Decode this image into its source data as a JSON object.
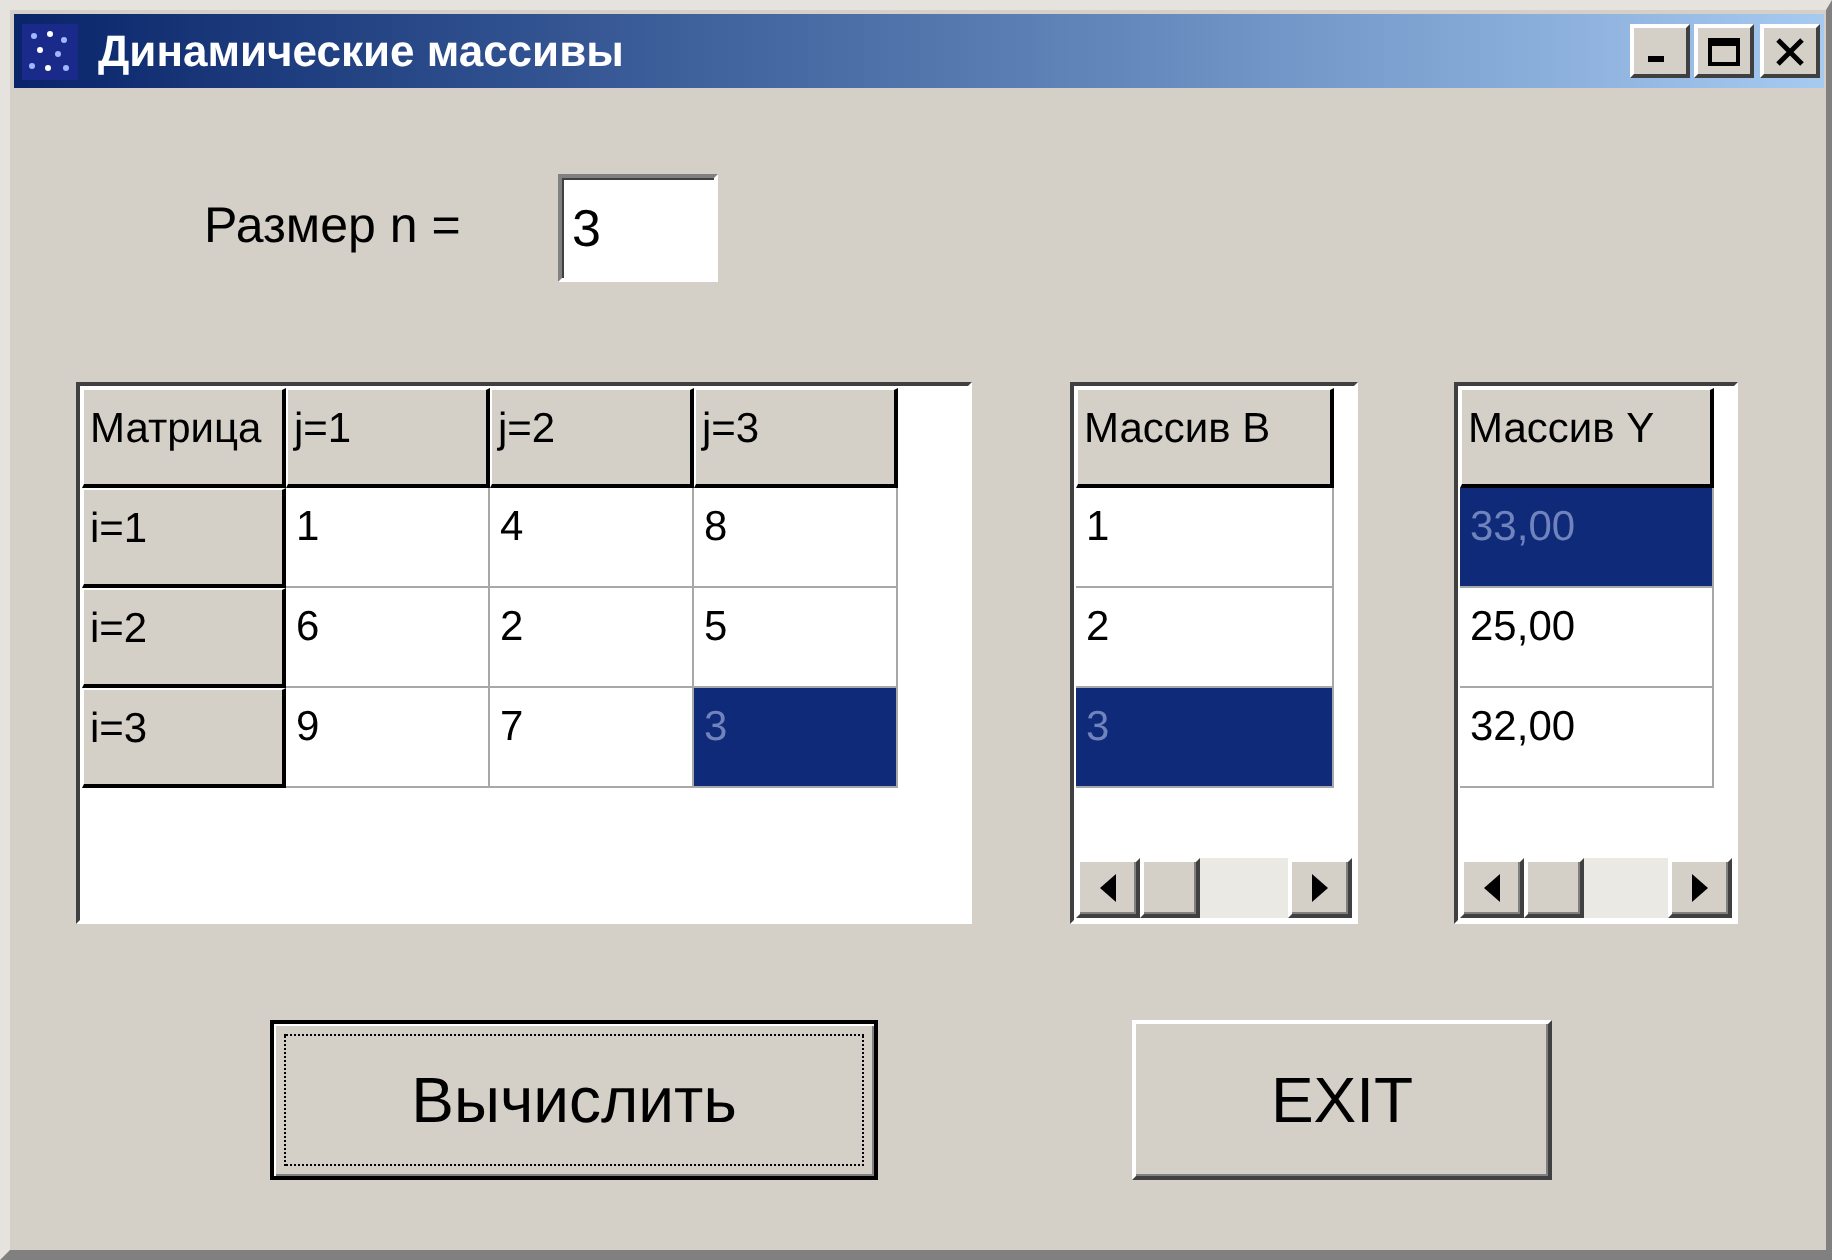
{
  "window": {
    "title": "Динамические массивы"
  },
  "size": {
    "label": "Размер n =",
    "value": "3"
  },
  "matrix": {
    "corner": "Матрица",
    "columns": [
      "j=1",
      "j=2",
      "j=3"
    ],
    "rows": [
      {
        "header": "i=1",
        "cells": [
          {
            "value": "1",
            "selected": false
          },
          {
            "value": "4",
            "selected": false
          },
          {
            "value": "8",
            "selected": false
          }
        ]
      },
      {
        "header": "i=2",
        "cells": [
          {
            "value": "6",
            "selected": false
          },
          {
            "value": "2",
            "selected": false
          },
          {
            "value": "5",
            "selected": false
          }
        ]
      },
      {
        "header": "i=3",
        "cells": [
          {
            "value": "9",
            "selected": false
          },
          {
            "value": "7",
            "selected": false
          },
          {
            "value": "3",
            "selected": true
          }
        ]
      }
    ]
  },
  "array_b": {
    "header": "Массив B",
    "rows": [
      {
        "value": "1",
        "selected": false
      },
      {
        "value": "2",
        "selected": false
      },
      {
        "value": "3",
        "selected": true
      }
    ]
  },
  "array_y": {
    "header": "Массив Y",
    "rows": [
      {
        "value": "33,00",
        "selected": true
      },
      {
        "value": "25,00",
        "selected": false
      },
      {
        "value": "32,00",
        "selected": false
      }
    ]
  },
  "buttons": [
    {
      "label": "Вычислить",
      "focused": true
    },
    {
      "label": "EXIT",
      "focused": false
    }
  ]
}
